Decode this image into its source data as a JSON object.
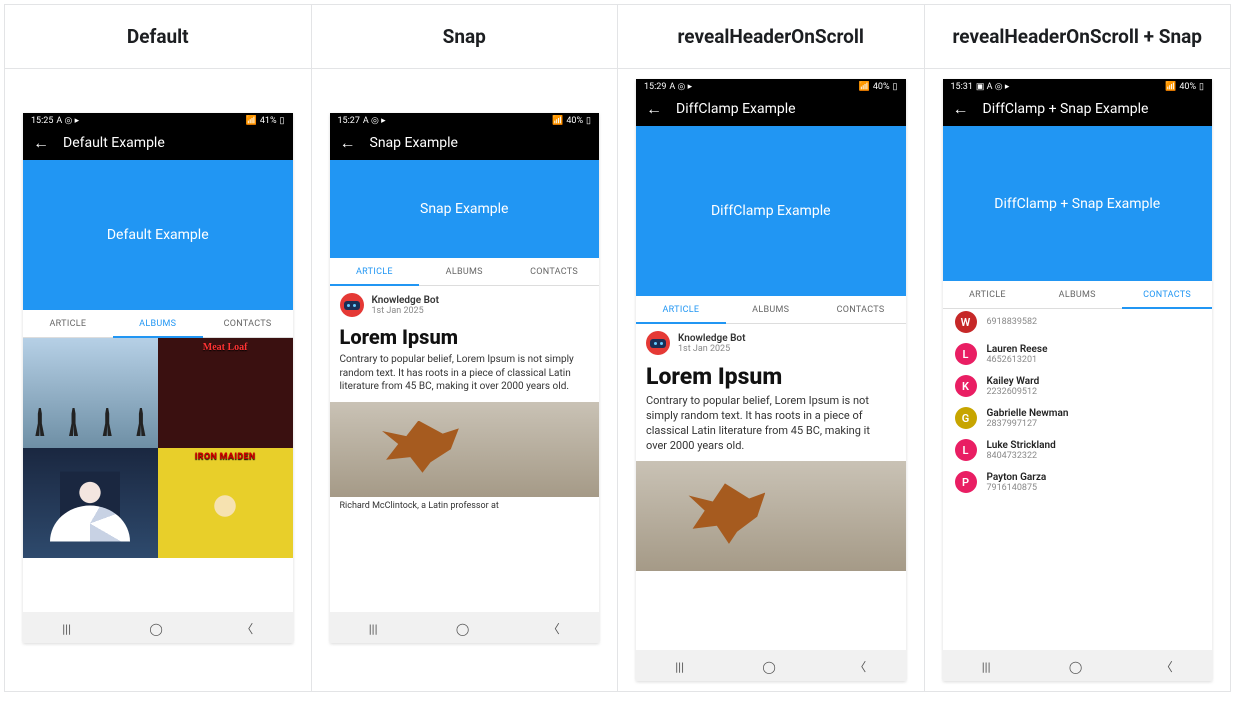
{
  "columns": {
    "c1": {
      "header": "Default"
    },
    "c2": {
      "header": "Snap"
    },
    "c3": {
      "header": "revealHeaderOnScroll"
    },
    "c4": {
      "header": "revealHeaderOnScroll + Snap"
    }
  },
  "tabs": {
    "article": "ARTICLE",
    "albums": "ALBUMS",
    "contacts": "CONTACTS"
  },
  "phone1": {
    "status": {
      "time": "15:25",
      "icons_left": "A ◎ ▸",
      "batt": "41%"
    },
    "topbar_title": "Default Example",
    "blue_title": "Default Example",
    "albums": {
      "a1": "",
      "a2": "Meat Loaf",
      "a3": "",
      "a4": "IRON MAIDEN"
    }
  },
  "phone2": {
    "status": {
      "time": "15:27",
      "icons_left": "A ◎ ▸",
      "batt": "40%"
    },
    "topbar_title": "Snap Example",
    "blue_title": "Snap Example",
    "article": {
      "author": "Knowledge Bot",
      "date": "1st Jan 2025",
      "title": "Lorem Ipsum",
      "body": "Contrary to popular belief, Lorem Ipsum is not simply random text. It has roots in a piece of classical Latin literature from 45 BC, making it over 2000 years old.",
      "caption": "Richard McClintock, a Latin professor at"
    }
  },
  "phone3": {
    "status": {
      "time": "15:29",
      "icons_left": "A ◎ ▸",
      "batt": "40%"
    },
    "topbar_title": "DiffClamp Example",
    "blue_title": "DiffClamp Example",
    "article": {
      "author": "Knowledge Bot",
      "date": "1st Jan 2025",
      "title": "Lorem Ipsum",
      "body": "Contrary to popular belief, Lorem Ipsum is not simply random text. It has roots in a piece of classical Latin literature from 45 BC, making it over 2000 years old."
    }
  },
  "phone4": {
    "status": {
      "time": "15:31",
      "icons_left": "▣ A ◎ ▸",
      "batt": "40%"
    },
    "topbar_title": "DiffClamp + Snap Example",
    "blue_title": "DiffClamp + Snap Example",
    "contacts": [
      {
        "initial": "W",
        "name": "",
        "phone": "6918839582",
        "color": "red"
      },
      {
        "initial": "L",
        "name": "Lauren Reese",
        "phone": "4652613201",
        "color": "pink"
      },
      {
        "initial": "K",
        "name": "Kailey Ward",
        "phone": "2232609512",
        "color": "pink"
      },
      {
        "initial": "G",
        "name": "Gabrielle Newman",
        "phone": "2837997127",
        "color": "yellow"
      },
      {
        "initial": "L",
        "name": "Luke Strickland",
        "phone": "8404732322",
        "color": "pink"
      },
      {
        "initial": "P",
        "name": "Payton Garza",
        "phone": "7916140875",
        "color": "pink"
      }
    ]
  }
}
